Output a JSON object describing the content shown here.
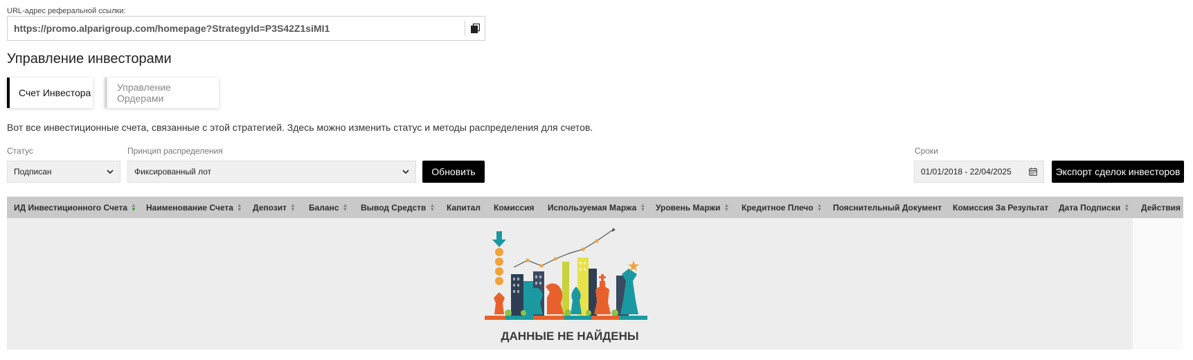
{
  "referral": {
    "label": "URL-адрес реферальной ссылки:",
    "url": "https://promo.alparigroup.com/homepage?StrategyId=P3S42Z1siMI1",
    "copy_icon": "copy-icon"
  },
  "section_title": "Управление инвесторами",
  "tabs": [
    {
      "label": "Счет Инвестора",
      "active": true
    },
    {
      "label": "Управление Ордерами",
      "active": false
    }
  ],
  "description": "Вот все инвестиционные счета, связанные с этой стратегией. Здесь можно изменить статус и методы распределения для счетов.",
  "filters": {
    "status_label": "Статус",
    "status_value": "Подписан",
    "distribution_label": "Принцип распределения",
    "distribution_value": "Фиксированный лот",
    "refresh_button": "Обновить",
    "period_label": "Сроки",
    "period_value": "01/01/2018 - 22/04/2025",
    "calendar_icon": "calendar-icon",
    "export_button": "Экспорт сделок инвесторов"
  },
  "table": {
    "columns": [
      {
        "label": "ИД Инвестиционного Счета",
        "sortable": true,
        "sorted": true
      },
      {
        "label": "Наименование Счета",
        "sortable": true
      },
      {
        "label": "Депозит",
        "sortable": true
      },
      {
        "label": "Баланс",
        "sortable": true
      },
      {
        "label": "Вывод Средств",
        "sortable": true
      },
      {
        "label": "Капитал",
        "sortable": false
      },
      {
        "label": "Комиссия",
        "sortable": false
      },
      {
        "label": "Используемая Маржа",
        "sortable": true
      },
      {
        "label": "Уровень Маржи",
        "sortable": true
      },
      {
        "label": "Кредитное Плечо",
        "sortable": true
      },
      {
        "label": "Пояснительный Документ",
        "sortable": false
      },
      {
        "label": "Комиссия За Результат",
        "sortable": false
      },
      {
        "label": "Дата Подписки",
        "sortable": true
      },
      {
        "label": "Действия",
        "sortable": false
      }
    ],
    "empty_message": "ДАННЫЕ НЕ НАЙДЕНЫ",
    "empty_illustration": "chess-city-illustration"
  },
  "colors": {
    "accent_black": "#000000",
    "sort_active": "#33a040",
    "header_bg": "#c9c9c9",
    "body_bg": "#ededed"
  }
}
